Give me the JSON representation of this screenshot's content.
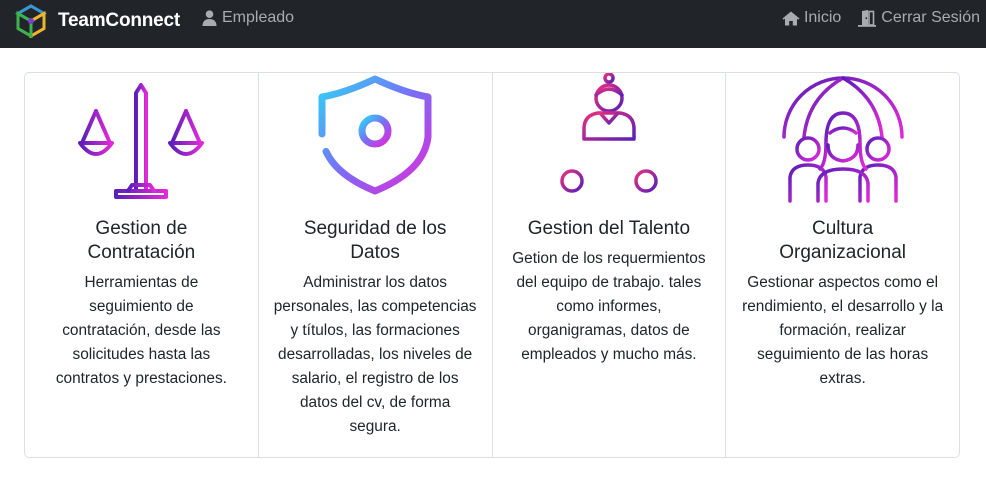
{
  "navbar": {
    "brand": "TeamConnect",
    "user_label": "Empleado",
    "links": [
      {
        "label": "Inicio",
        "icon": "home-icon"
      },
      {
        "label": "Cerrar Sesión",
        "icon": "door-exit-icon"
      }
    ]
  },
  "cards": [
    {
      "icon": "scales-icon",
      "title": "Gestion de Contratación",
      "text": "Herramientas de seguimiento de contratación, desde las solicitudes hasta las contratos y prestaciones."
    },
    {
      "icon": "shield-keyhole-icon",
      "title": "Seguridad de los Datos",
      "text": "Administrar los datos personales, las competencias y títulos, las formaciones desarrolladas, los niveles de salario, el registro de los datos del cv, de forma segura."
    },
    {
      "icon": "org-chart-person-icon",
      "title": "Gestion del Talento",
      "text": "Getion de los requermientos del equipo de trabajo. tales como informes, organigramas, datos de empleados y mucho más."
    },
    {
      "icon": "globe-people-icon",
      "title": "Cultura Organizacional",
      "text": "Gestionar aspectos como el rendimiento, el desarrollo y la formación, realizar seguimiento de las horas extras."
    }
  ],
  "colors": {
    "navbar_bg": "#212529",
    "nav_text": "#a8acb0",
    "gradient_purple": "#5b1fb8",
    "gradient_magenta": "#e22ad8",
    "gradient_cyan": "#2fd3f5",
    "gradient_pink": "#e8307f"
  }
}
